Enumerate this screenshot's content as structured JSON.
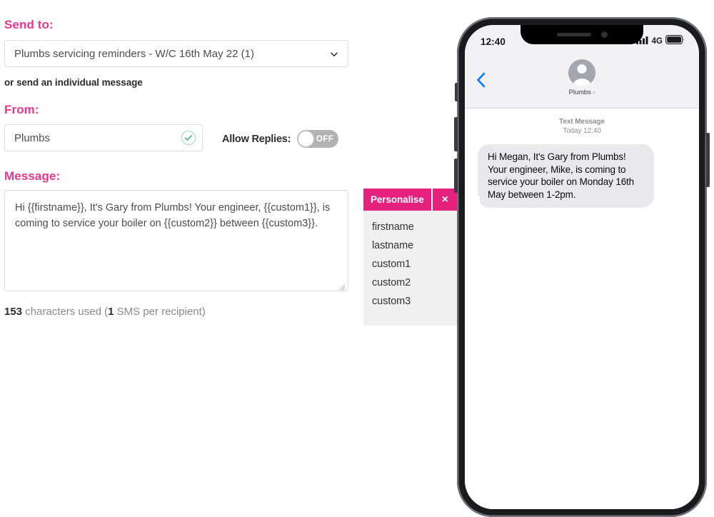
{
  "form": {
    "send_to_label": "Send to:",
    "send_to_value": "Plumbs servicing reminders - W/C 16th May 22 (1)",
    "individual_hint": "or send an individual message",
    "from_label": "From:",
    "from_value": "Plumbs",
    "allow_replies_label": "Allow Replies:",
    "allow_replies_state": "OFF",
    "message_label": "Message:",
    "message_value": "Hi {{firstname}}, It's Gary from Plumbs! Your engineer, {{custom1}}, is coming to service your boiler on {{custom2}} between {{custom3}}.",
    "char_count": "153",
    "char_count_mid": " characters used (",
    "sms_count": "1",
    "char_count_end": " SMS per recipient)"
  },
  "personalise": {
    "title": "Personalise",
    "close_label": "×",
    "tokens": [
      {
        "label": "firstname"
      },
      {
        "label": "lastname"
      },
      {
        "label": "custom1"
      },
      {
        "label": "custom2"
      },
      {
        "label": "custom3"
      }
    ]
  },
  "phone": {
    "status": {
      "time": "12:40",
      "network": "4G"
    },
    "chat": {
      "contact_name": "Plumbs",
      "contact_arrow": "›",
      "meta_line1": "Text Message",
      "meta_line2": "Today 12:40",
      "bubble_text": "Hi Megan, It's Gary from Plumbs! Your engineer, Mike, is coming to service your boiler on Monday 16th May between 1-2pm."
    }
  },
  "colors": {
    "brand_pink": "#E8368F",
    "panel_pink": "#E5207E",
    "ios_blue": "#007AFF",
    "bubble_grey": "#e9e9eb",
    "check_green": "#5cbf8a"
  }
}
